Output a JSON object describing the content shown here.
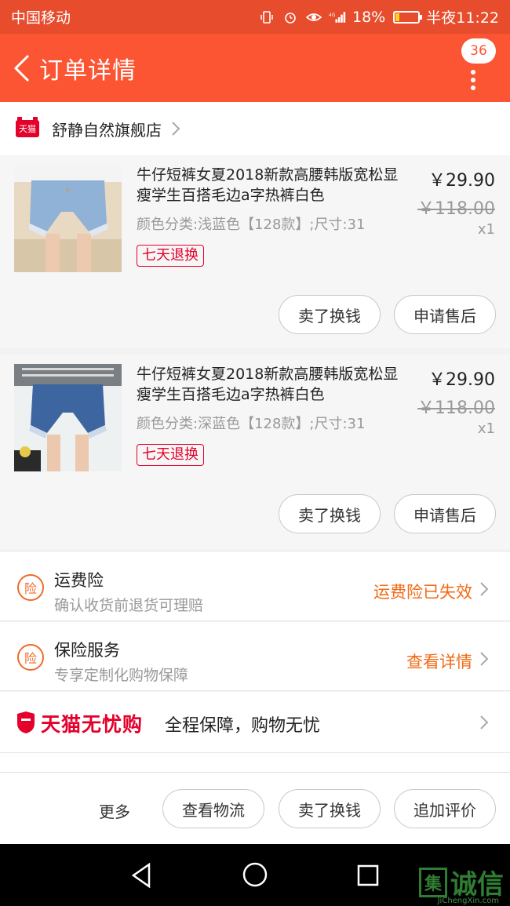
{
  "status_bar": {
    "carrier": "中国移动",
    "battery": "18%",
    "time": "半夜11:22",
    "network": "4G"
  },
  "header": {
    "title": "订单详情",
    "badge_count": "36"
  },
  "shop": {
    "logo_text": "天猫",
    "name": "舒静自然旗舰店"
  },
  "items": [
    {
      "title": "牛仔短裤女夏2018新款高腰韩版宽松显瘦学生百搭毛边a字热裤白色",
      "spec": "颜色分类:浅蓝色【128款】;尺寸:31",
      "tag": "七天退换",
      "price": "￥29.90",
      "original_price": "￥118.00",
      "quantity": "x1",
      "buttons": [
        "卖了换钱",
        "申请售后"
      ]
    },
    {
      "title": "牛仔短裤女夏2018新款高腰韩版宽松显瘦学生百搭毛边a字热裤白色",
      "spec": "颜色分类:深蓝色【128款】;尺寸:31",
      "tag": "七天退换",
      "price": "￥29.90",
      "original_price": "￥118.00",
      "quantity": "x1",
      "buttons": [
        "卖了换钱",
        "申请售后"
      ]
    }
  ],
  "insurance": [
    {
      "icon_text": "险",
      "title": "运费险",
      "subtitle": "确认收货前退货可理赔",
      "status": "运费险已失效"
    },
    {
      "icon_text": "险",
      "title": "保险服务",
      "subtitle": "专享定制化购物保障",
      "status": "查看详情"
    }
  ],
  "guarantee": {
    "brand": "天猫无忧购",
    "slogan": "全程保障，购物无忧"
  },
  "bottom_bar": {
    "more": "更多",
    "buttons": [
      "查看物流",
      "卖了换钱",
      "追加评价"
    ]
  },
  "watermark": {
    "logo_char": "集",
    "text": "诚信",
    "url": "JiChengXin.com"
  },
  "colors": {
    "status_bar": "#e74c2c",
    "header": "#fb5533",
    "tmall_red": "#e4002b",
    "insurance_orange": "#f06a15"
  }
}
